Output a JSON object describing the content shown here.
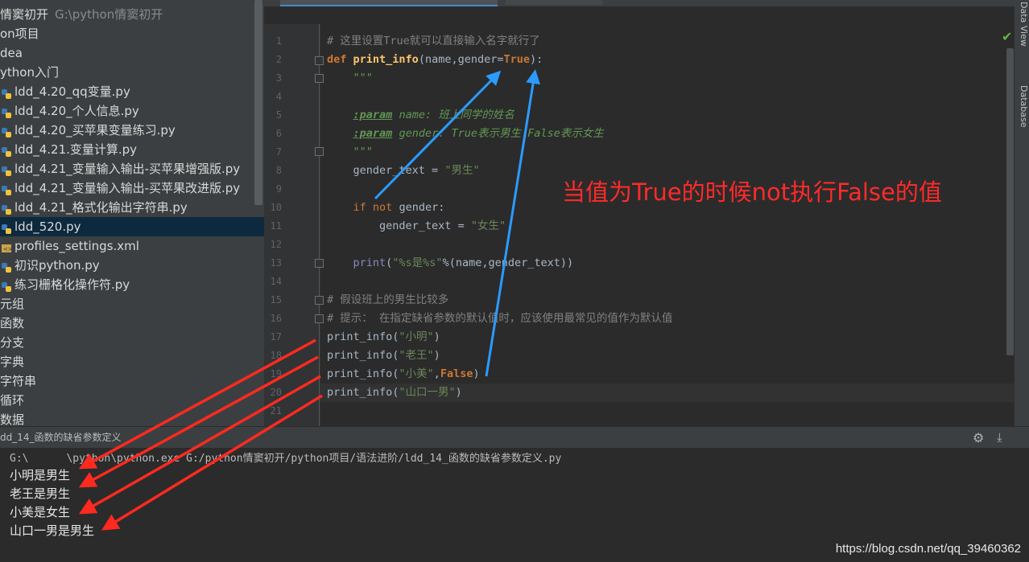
{
  "project": {
    "root_label": "情窦初开",
    "root_path": "G:\\python情窦初开",
    "items": [
      {
        "label": "on项目",
        "icon": "none",
        "indent": 0
      },
      {
        "label": "dea",
        "icon": "none",
        "indent": 0
      },
      {
        "label": "ython入门",
        "icon": "none",
        "indent": 0
      },
      {
        "label": "ldd_4.20_qq变量.py",
        "icon": "python-file-icon",
        "indent": 1
      },
      {
        "label": "ldd_4.20_个人信息.py",
        "icon": "python-file-icon",
        "indent": 1
      },
      {
        "label": "ldd_4.20_买苹果变量练习.py",
        "icon": "python-file-icon",
        "indent": 1
      },
      {
        "label": "ldd_4.21.变量计算.py",
        "icon": "python-file-icon",
        "indent": 1
      },
      {
        "label": "ldd_4.21_变量输入输出-买苹果增强版.py",
        "icon": "python-file-icon",
        "indent": 1
      },
      {
        "label": "ldd_4.21_变量输入输出-买苹果改进版.py",
        "icon": "python-file-icon",
        "indent": 1
      },
      {
        "label": "ldd_4.21_格式化输出字符串.py",
        "icon": "python-file-icon",
        "indent": 1
      },
      {
        "label": "ldd_520.py",
        "icon": "python-file-icon",
        "indent": 1,
        "selected": true
      },
      {
        "label": "profiles_settings.xml",
        "icon": "xml-file-icon",
        "indent": 1
      },
      {
        "label": "初识python.py",
        "icon": "python-file-icon",
        "indent": 1
      },
      {
        "label": "练习栅格化操作符.py",
        "icon": "python-file-icon",
        "indent": 1
      },
      {
        "label": "元组",
        "icon": "none",
        "indent": 0
      },
      {
        "label": "函数",
        "icon": "none",
        "indent": 0
      },
      {
        "label": "分支",
        "icon": "none",
        "indent": 0
      },
      {
        "label": "字典",
        "icon": "none",
        "indent": 0
      },
      {
        "label": "字符串",
        "icon": "none",
        "indent": 0
      },
      {
        "label": "循环",
        "icon": "none",
        "indent": 0
      },
      {
        "label": "数据",
        "icon": "none",
        "indent": 0
      }
    ]
  },
  "editor": {
    "line_numbers": [
      "1",
      "2",
      "3",
      "4",
      "5",
      "6",
      "7",
      "8",
      "9",
      "10",
      "11",
      "12",
      "13",
      "14",
      "15",
      "16",
      "17",
      "18",
      "19",
      "20",
      "21"
    ],
    "lines": {
      "l1": "# 这里设置True就可以直接输入名字就行了",
      "l2_def": "def",
      "l2_fn": "print_info",
      "l2_open": "(name,gender=",
      "l2_true": "True",
      "l2_close": "):",
      "l3": "\"\"\"",
      "l5_tag": ":param",
      "l5_param": "name:",
      "l5_text": " 班上同学的姓名",
      "l6_tag": ":param",
      "l6_param": "gender:",
      "l6_text": " True表示男生 False表示女生",
      "l7": "\"\"\"",
      "l8_var": "gender_text = ",
      "l8_str": "\"男生\"",
      "l10_if": "if",
      "l10_not": "not",
      "l10_rest": " gender:",
      "l11_var": "gender_text = ",
      "l11_str": "\"女生\"",
      "l13_print": "print",
      "l13_open": "(",
      "l13_str": "\"%s是%s\"",
      "l13_rest": "%(name,gender_text))",
      "l15": "# 假设班上的男生比较多",
      "l16": "# 提示： 在指定缺省参数的默认值时，应该使用最常见的值作为默认值",
      "l17_call": "print_info(",
      "l17_str": "\"小明\"",
      "l17_close": ")",
      "l18_call": "print_info(",
      "l18_str": "\"老王\"",
      "l18_close": ")",
      "l19_call": "print_info(",
      "l19_str": "\"小美\"",
      "l19_comma": ",",
      "l19_false": "False",
      "l19_close": ")",
      "l20_call": "print_info(",
      "l20_str": "\"山口一男\"",
      "l20_close": ")"
    }
  },
  "right_tools": {
    "data_view": "Data View",
    "database": "Database"
  },
  "run_panel": {
    "title": "dd_14_函数的缺省参数定义",
    "command": "G:\\      \\python\\python.exe G:/python情窦初开/python项目/语法进阶/ldd_14_函数的缺省参数定义.py",
    "outputs": [
      "小明是男生",
      "老王是男生",
      "小美是女生",
      "山口一男是男生"
    ]
  },
  "annotation": "当值为True的时候not执行False的值",
  "watermark": "https://blog.csdn.net/qq_39460362",
  "colors": {
    "arrow_red": "#ff2a1f",
    "arrow_blue": "#2a9bff",
    "annotation_red": "#ff2a2a"
  }
}
